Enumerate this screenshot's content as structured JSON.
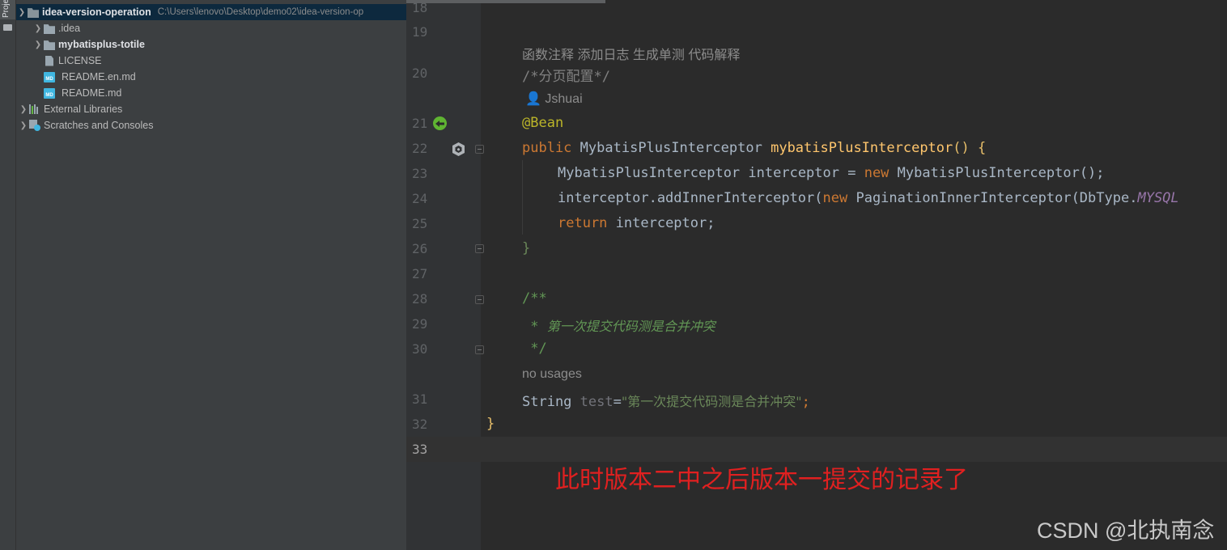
{
  "tool_window": {
    "stripe_label": "Project"
  },
  "project_tree": {
    "root_name": "idea-version-operation",
    "root_path": "C:\\Users\\lenovo\\Desktop\\demo02\\idea-version-op",
    "items": [
      {
        "label": ".idea"
      },
      {
        "label": "mybatisplus-totile"
      },
      {
        "label": "LICENSE"
      },
      {
        "label": "README.en.md"
      },
      {
        "label": "README.md"
      },
      {
        "label": "External Libraries"
      },
      {
        "label": "Scratches and Consoles"
      }
    ]
  },
  "editor": {
    "line_numbers": [
      "18",
      "19",
      "20",
      "21",
      "22",
      "23",
      "24",
      "25",
      "26",
      "27",
      "28",
      "29",
      "30",
      "31",
      "32",
      "33"
    ],
    "hints": {
      "actions": "函数注释 添加日志 生成单测 代码解释",
      "author": "Jshuai",
      "usages": "no usages"
    },
    "tokens": {
      "l20_comment": "/*分页配置*/",
      "l21_annotation": "@Bean",
      "l22_public": "public",
      "l22_type": "MybatisPlusInterceptor",
      "l22_method": "mybatisPlusInterceptor",
      "l22_rest": "() {",
      "l23_type": "MybatisPlusInterceptor",
      "l23_var": " interceptor = ",
      "l23_new": "new",
      "l23_ctor": " MybatisPlusInterceptor();",
      "l24_call": "interceptor.addInnerInterceptor(",
      "l24_new": "new",
      "l24_ctor": " PaginationInnerInterceptor(DbType.",
      "l24_field": "MYSQL",
      "l25_return": "return",
      "l25_var": " interceptor;",
      "l26_close": "}",
      "l28_doc_open": "/**",
      "l29_doc_star": " * ",
      "l29_doc_text": "第一次提交代码测是合并冲突",
      "l30_doc_close": " */",
      "l31_type": "String",
      "l31_var": "test",
      "l31_eq": "=",
      "l31_str": "\"第一次提交代码测是合并冲突\"",
      "l31_semi": ";",
      "l32_close": "}"
    }
  },
  "annotation_overlay": "此时版本二中之后版本一提交的记录了",
  "watermark": "CSDN @北执南念",
  "colors": {
    "keyword": "#cc7832",
    "method": "#ffc66d",
    "string": "#6a8759",
    "annotation": "#bbb529",
    "overlay_red": "#e02020"
  }
}
